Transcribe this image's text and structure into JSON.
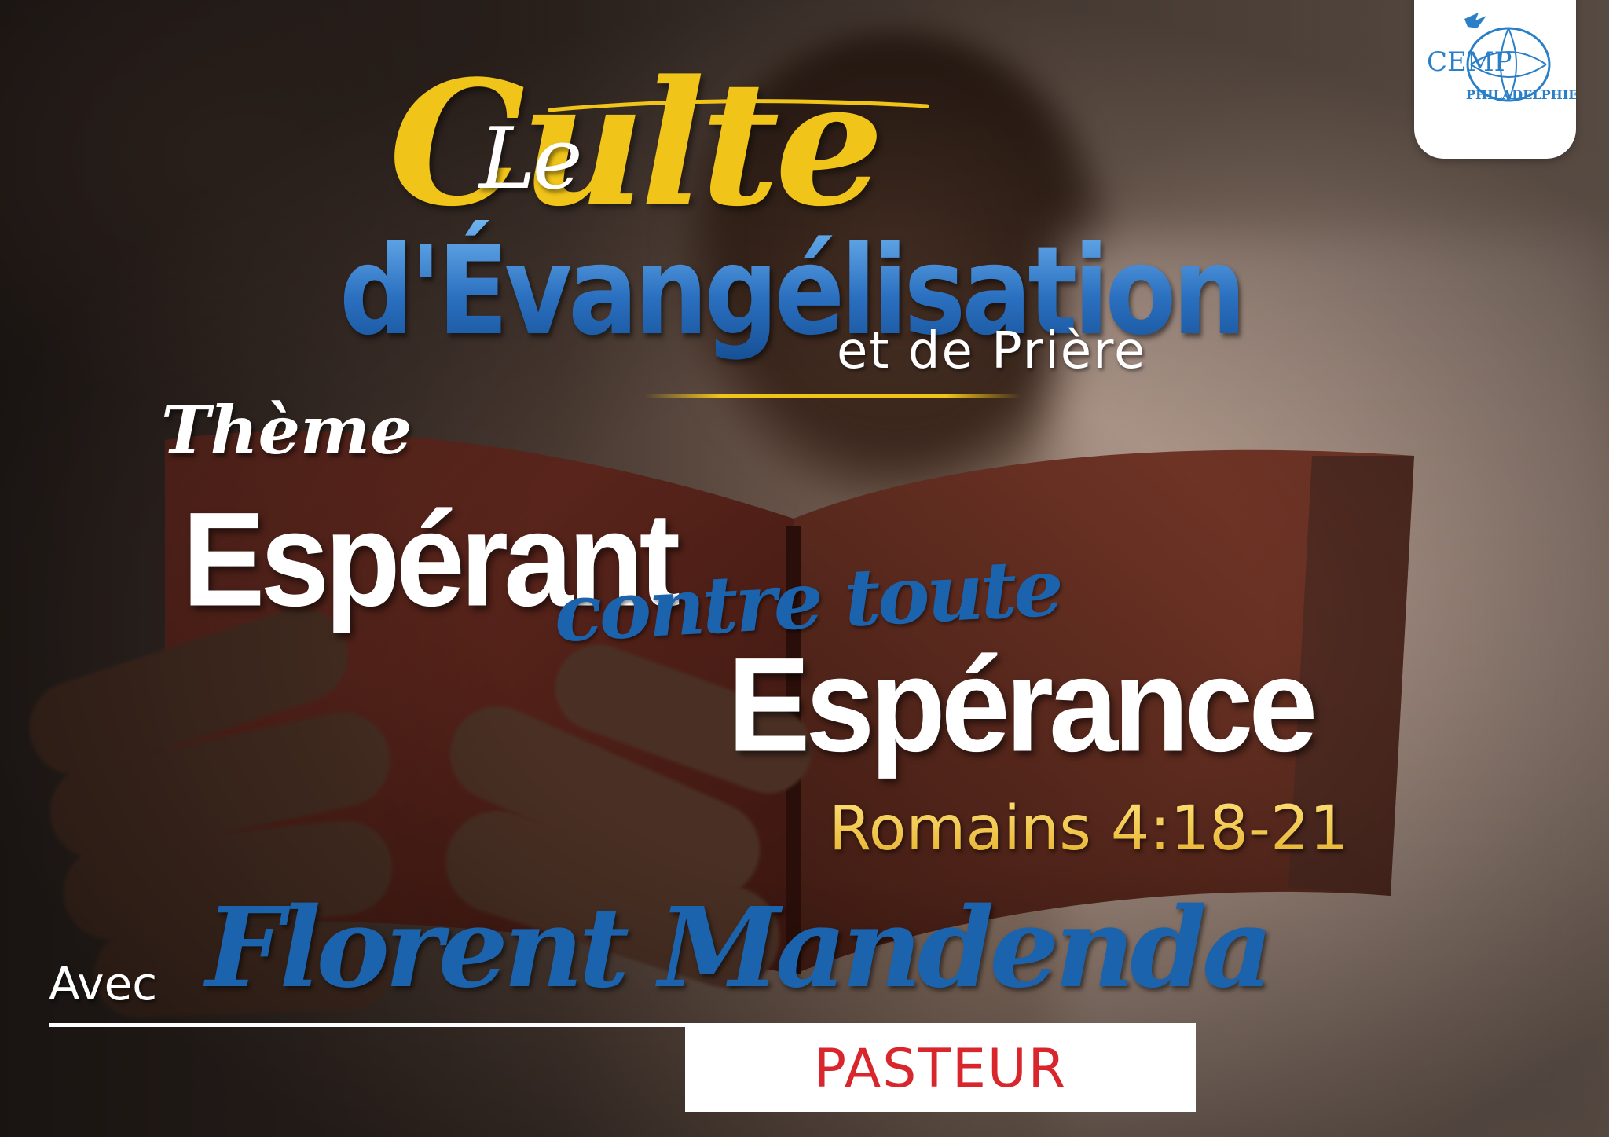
{
  "header": {
    "title_line1": "Le",
    "title_line2": "Culte",
    "title_line3": "d'Évangélisation",
    "title_line4": "et de Prière"
  },
  "logo": {
    "text": "CEMP",
    "subtitle": "PHILADELPHIE",
    "icon": "dove-globe-icon"
  },
  "theme": {
    "label": "Thème",
    "line1": "Espérant",
    "line2": "contre toute",
    "line3": "Espérance",
    "scripture": "Romains 4:18-21"
  },
  "speaker": {
    "prefix": "Avec",
    "name": "Florent Mandenda",
    "role": "PASTEUR"
  },
  "colors": {
    "gold": "#f0c419",
    "blue": "#1c63ad",
    "red": "#d8262c",
    "white": "#ffffff"
  }
}
